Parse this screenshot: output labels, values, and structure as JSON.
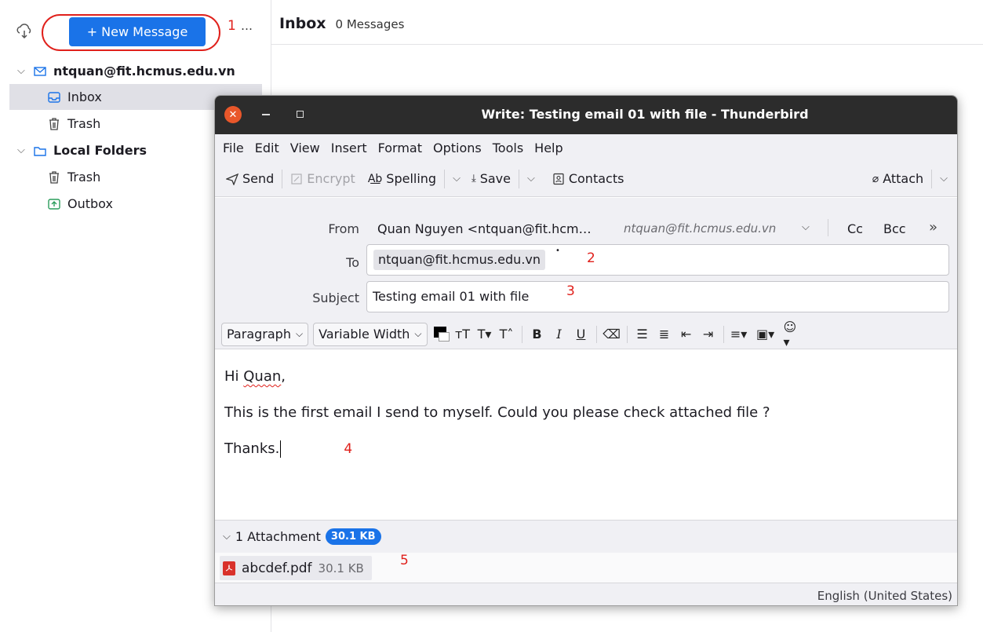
{
  "sidebar": {
    "new_message_label": "+ New Message",
    "more_label": "…",
    "account_label": "ntquan@fit.hcmus.edu.vn",
    "items": [
      {
        "label": "Inbox"
      },
      {
        "label": "Trash"
      },
      {
        "label": "Local Folders"
      },
      {
        "label": "Trash"
      },
      {
        "label": "Outbox"
      }
    ]
  },
  "inbox": {
    "title": "Inbox",
    "count": "0 Messages"
  },
  "annotations": [
    "1",
    "2",
    "3",
    "4",
    "5"
  ],
  "compose": {
    "window_title": "Write: Testing email 01 with file - Thunderbird",
    "menu": [
      "File",
      "Edit",
      "View",
      "Insert",
      "Format",
      "Options",
      "Tools",
      "Help"
    ],
    "toolbar": {
      "send": "Send",
      "encrypt": "Encrypt",
      "spelling": "Spelling",
      "save": "Save",
      "contacts": "Contacts",
      "attach": "Attach"
    },
    "headers": {
      "from_label": "From",
      "from_value": "Quan Nguyen <ntquan@fit.hcm…",
      "from_identity": "ntquan@fit.hcmus.edu.vn",
      "cc": "Cc",
      "bcc": "Bcc",
      "more": "»",
      "to_label": "To",
      "to_value": "ntquan@fit.hcmus.edu.vn",
      "subject_label": "Subject",
      "subject_value": "Testing email 01 with file"
    },
    "format": {
      "paragraph": "Paragraph",
      "font": "Variable Width",
      "text_color": "#000000"
    },
    "body": {
      "greeting_prefix": "Hi ",
      "greeting_name": "Quan",
      "greeting_suffix": ",",
      "line2": "This is the first email I send to myself. Could you please check attached file ?",
      "line3": "Thanks."
    },
    "attachments": {
      "summary": "1 Attachment",
      "total_size": "30.1 KB",
      "files": [
        {
          "name": "abcdef.pdf",
          "size": "30.1 KB"
        }
      ]
    },
    "status": {
      "language": "English (United States)"
    }
  },
  "colors": {
    "accent": "#1a73e8",
    "annotation": "#e0201b",
    "titlebar": "#2c2c2c"
  }
}
